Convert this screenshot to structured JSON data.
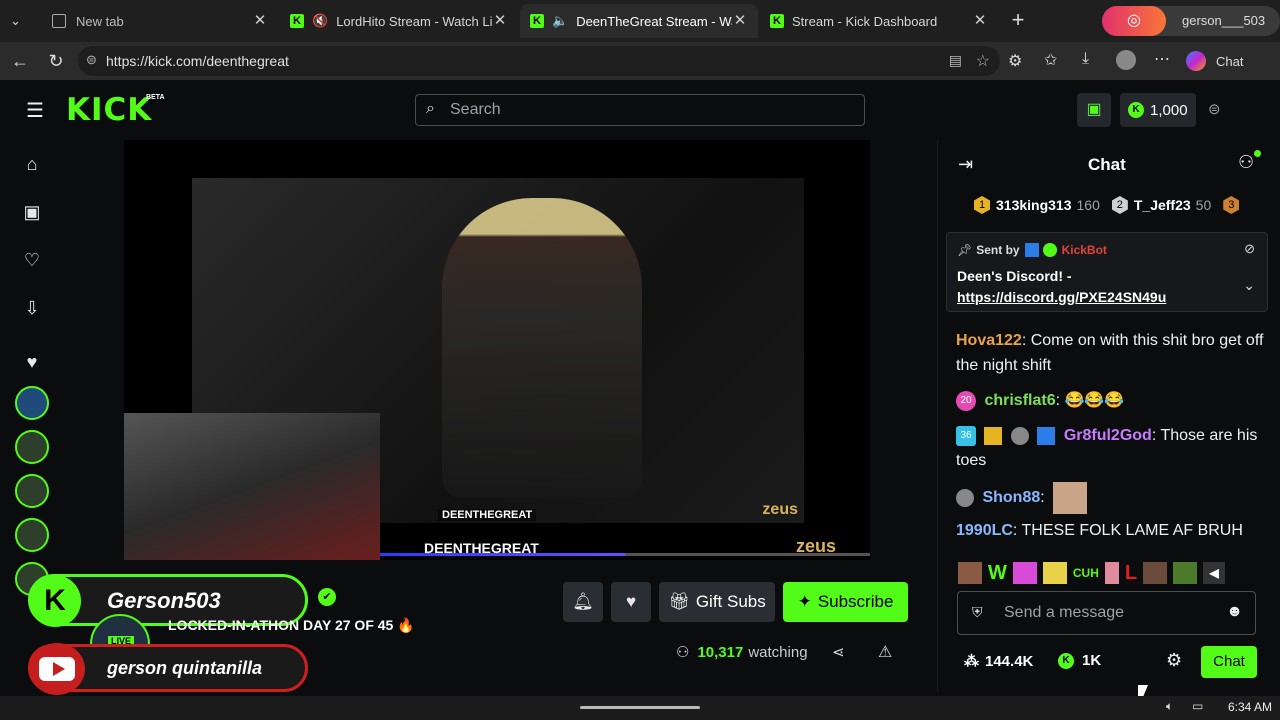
{
  "browser": {
    "tabs": [
      {
        "label": "New tab",
        "active": false
      },
      {
        "label": "LordHito Stream - Watch Live",
        "active": false
      },
      {
        "label": "DeenTheGreat Stream - Watch",
        "active": true
      },
      {
        "label": "Stream - Kick Dashboard",
        "active": false
      }
    ],
    "profile_name": "gerson___503",
    "url": "https://kick.com/deenthegreat",
    "chat_label": "Chat"
  },
  "kick": {
    "logo": "KICK",
    "beta": "BETA",
    "search_placeholder": "Search",
    "points": "1,000"
  },
  "video": {
    "watermark": "DEENTHEGREAT",
    "brand": "zeus"
  },
  "overlay": {
    "name1": "Gerson503",
    "name2": "gerson quintanilla"
  },
  "stream": {
    "live_badge": "LIVE",
    "title": "LOCKED-IN-ATHON DAY 27 OF 45 🔥",
    "viewers": "10,317",
    "watching_label": "watching",
    "gift_label": "Gift Subs",
    "subscribe_label": "Subscribe"
  },
  "chat": {
    "title": "Chat",
    "leaders": [
      {
        "rank": "1",
        "name": "313king313",
        "count": "160"
      },
      {
        "rank": "2",
        "name": "T_Jeff23",
        "count": "50"
      },
      {
        "rank": "3",
        "name": "",
        "count": ""
      }
    ],
    "pinned": {
      "sent_by": "Sent by",
      "bot": "KickBot",
      "text": "Deen's Discord! -",
      "link": "https://discord.gg/PXE24SN49u"
    },
    "messages": [
      {
        "user": "Hova122",
        "color": "#e6a34c",
        "text": "Come on with this shit bro get off the night shift"
      },
      {
        "user": "chrisflat6",
        "color": "#7ee05a",
        "badge": "20",
        "text": "😂😂😂"
      },
      {
        "user": "Gr8ful2God",
        "color": "#c77dff",
        "badge": "36",
        "text": "Those are his toes"
      },
      {
        "user": "Shon88",
        "color": "#8ab8ff",
        "text": ""
      },
      {
        "user": "1990LC",
        "color": "#8ab8ff",
        "text": "THESE FOLK LAME AF BRUH"
      }
    ],
    "emotes": [
      "W",
      "CUH",
      "L"
    ],
    "input_placeholder": "Send a message",
    "followers": "144.4K",
    "kicks": "1K",
    "send_label": "Chat"
  },
  "taskbar": {
    "time": "6:34 AM"
  }
}
